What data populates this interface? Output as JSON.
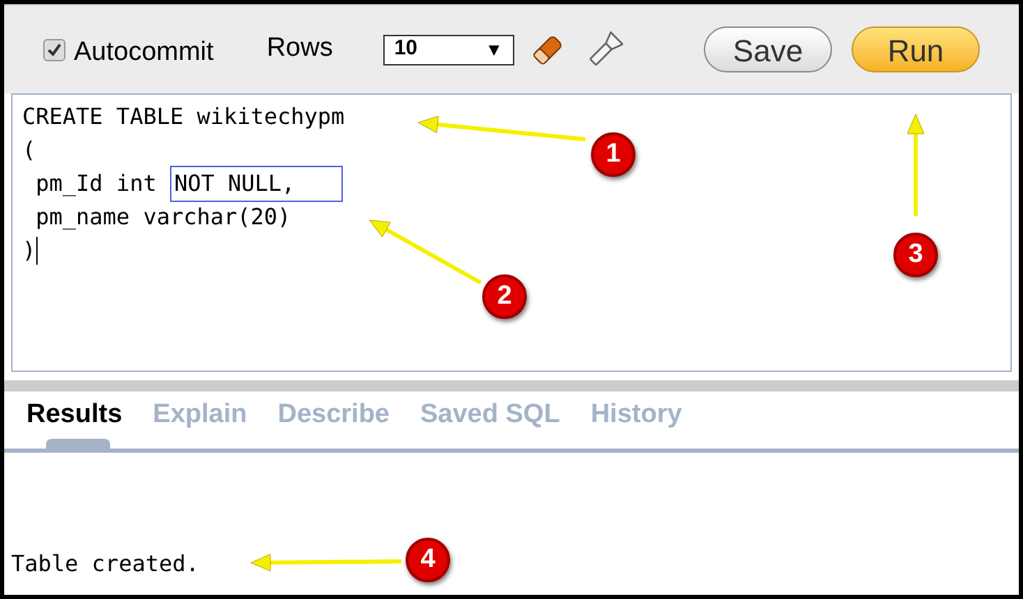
{
  "toolbar": {
    "autocommit": {
      "label": "Autocommit",
      "checked": true
    },
    "rows_label": "Rows",
    "rows_select": {
      "value": "10",
      "arrow": "▼"
    },
    "buttons": [
      {
        "label": "Save",
        "kind": "plain"
      },
      {
        "label": "Run",
        "kind": "primary"
      }
    ]
  },
  "editor": {
    "lines": [
      {
        "text": "CREATE TABLE wikitechypm"
      },
      {
        "text": "("
      },
      {
        "text": " pm_Id int ",
        "boxed": "NOT NULL,"
      },
      {
        "text": " pm_name varchar(20)"
      },
      {
        "text": ")",
        "cursor": true
      }
    ]
  },
  "tabs": [
    {
      "label": "Results",
      "selected": true
    },
    {
      "label": "Explain",
      "selected": false
    },
    {
      "label": "Describe",
      "selected": false
    },
    {
      "label": "Saved SQL",
      "selected": false
    },
    {
      "label": "History",
      "selected": false
    }
  ],
  "output": "Table created.",
  "callouts": [
    {
      "label": "1"
    },
    {
      "label": "2"
    },
    {
      "label": "3"
    },
    {
      "label": "4"
    }
  ]
}
